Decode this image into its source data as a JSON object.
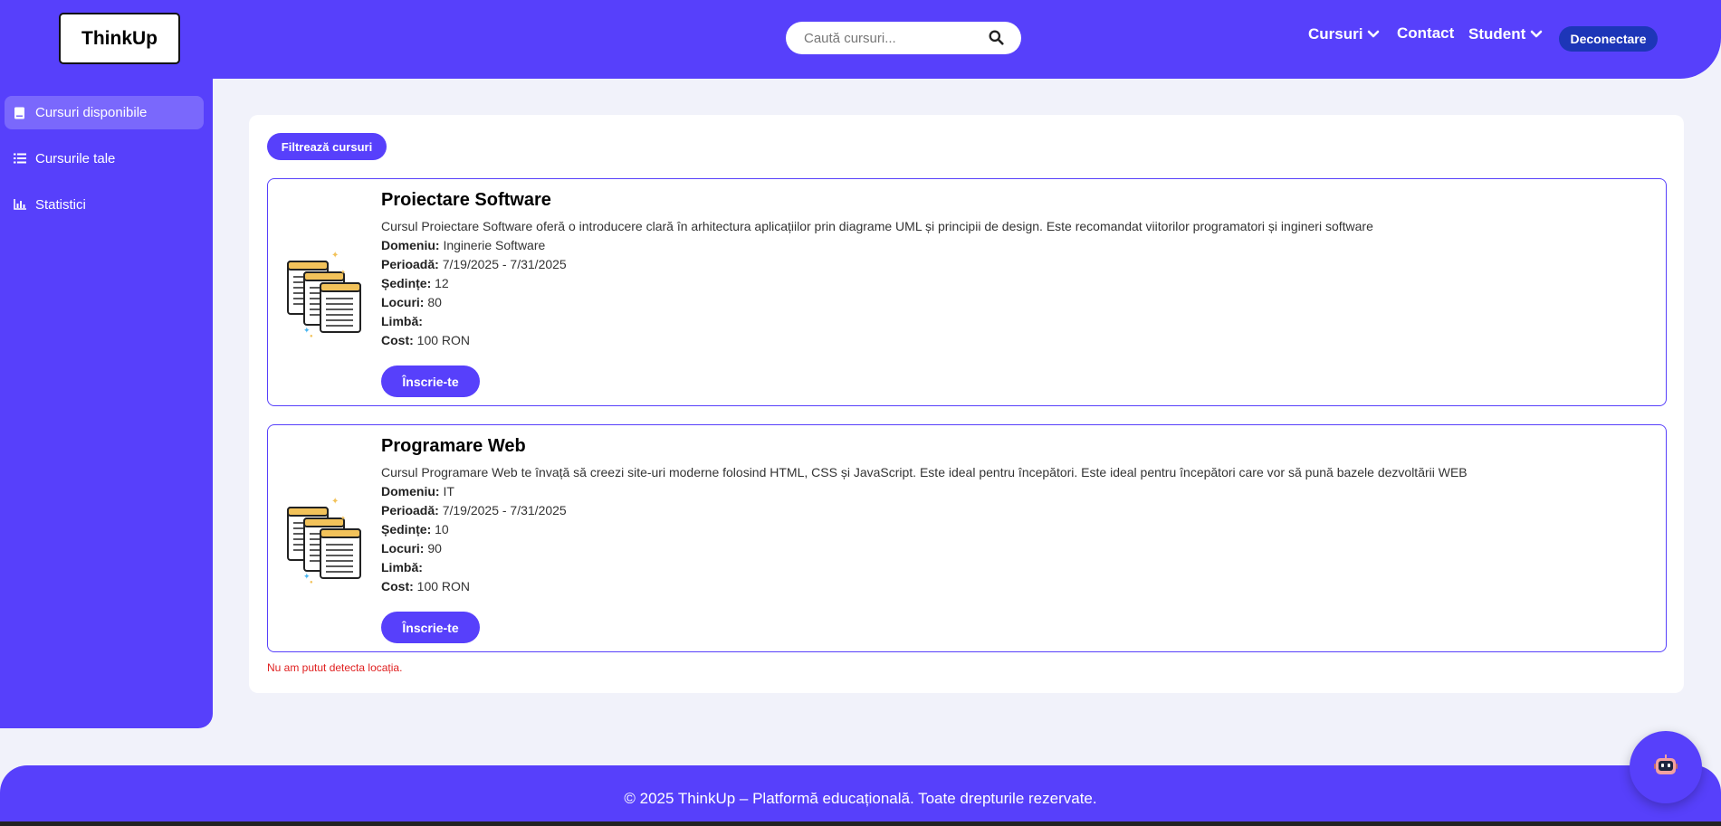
{
  "header": {
    "logo": "ThinkUp",
    "search_placeholder": "Caută cursuri...",
    "nav": {
      "courses": "Cursuri",
      "contact": "Contact",
      "student": "Student",
      "logout": "Deconectare"
    }
  },
  "sidebar": {
    "items": [
      {
        "label": "Cursuri disponibile",
        "icon": "book-icon",
        "active": true
      },
      {
        "label": "Cursurile tale",
        "icon": "list-icon",
        "active": false
      },
      {
        "label": "Statistici",
        "icon": "chart-icon",
        "active": false
      }
    ]
  },
  "main": {
    "filter_label": "Filtrează cursuri",
    "field_labels": {
      "domain": "Domeniu:",
      "period": "Perioadă:",
      "sessions": "Ședințe:",
      "seats": "Locuri:",
      "language": "Limbă:",
      "cost": "Cost:"
    },
    "enroll_label": "Înscrie-te",
    "courses": [
      {
        "title": "Proiectare Software",
        "description": "Cursul Proiectare Software oferă o introducere clară în arhitectura aplicațiilor prin diagrame UML și principii de design. Este recomandat viitorilor programatori și ingineri software",
        "domain": "Inginerie Software",
        "period": "7/19/2025 - 7/31/2025",
        "sessions": "12",
        "seats": "80",
        "language": "",
        "cost": "100 RON"
      },
      {
        "title": "Programare Web",
        "description": "Cursul Programare Web te învață să creezi site-uri moderne folosind HTML, CSS și JavaScript. Este ideal pentru începători. Este ideal pentru începători care vor să pună bazele dezvoltării WEB",
        "domain": "IT",
        "period": "7/19/2025 - 7/31/2025",
        "sessions": "10",
        "seats": "90",
        "language": "",
        "cost": "100 RON"
      }
    ],
    "location_error": "Nu am putut detecta locația."
  },
  "footer": {
    "text": "© 2025 ThinkUp – Platformă educațională. Toate drepturile rezervate."
  },
  "colors": {
    "primary": "#5740fb",
    "logout_bg": "#1d36b8",
    "error": "#e02020"
  }
}
